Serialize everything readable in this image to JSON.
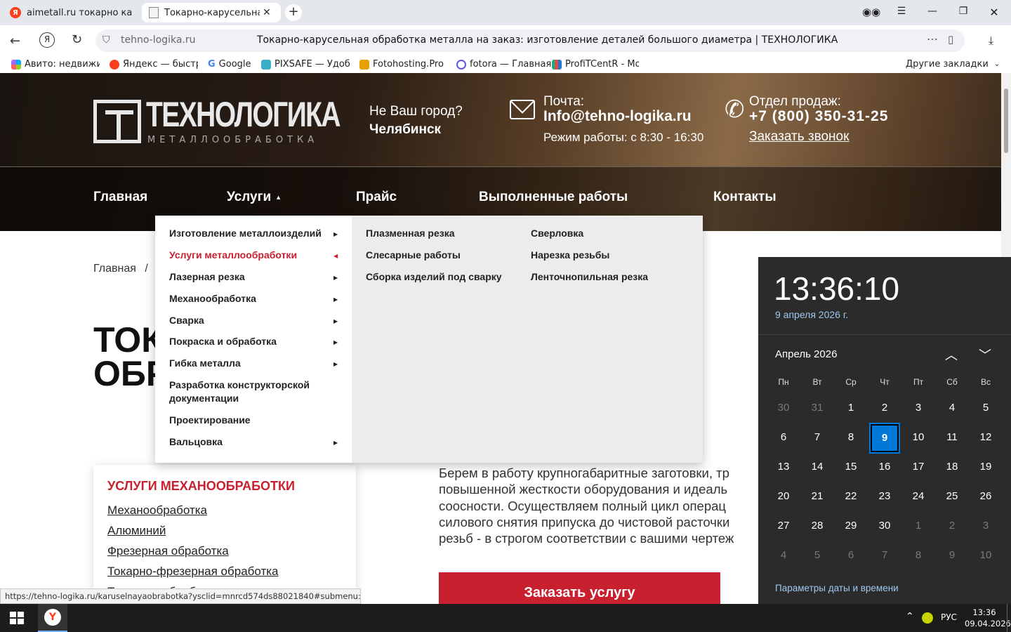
{
  "browser": {
    "tabs": [
      {
        "title": "aimetall.ru токарно карус"
      },
      {
        "title": "Токарно-карусельная о"
      }
    ],
    "new_tab": "+",
    "url": "tehno-logika.ru",
    "page_title": "Токарно-карусельная обработка металла на заказ: изготовление деталей большого диаметра | ТЕХНОЛОГИКА",
    "bookmarks": [
      "Авито: недвижим",
      "Яндекс — быстрі",
      "Google",
      "PIXSAFE — Удобн",
      "Fotohosting.Pro - ",
      "fotora — Главная",
      "ProfiTCentR - Мой"
    ],
    "other_bookmarks": "Другие закладки",
    "status_url": "https://tehno-logika.ru/karuselnayaobrabotka?ysclid=mnrcd574ds88021840#submenu:uslugi"
  },
  "site": {
    "logo_main": "ТЕХНОЛОГИКА",
    "logo_sub": "МЕТАЛЛООБРАБОТКА",
    "city_question": "Не Ваш город?",
    "city": "Челябинск",
    "mail_label": "Почта:",
    "mail": "Info@tehno-logika.ru",
    "hours": "Режим работы: с 8:30 - 16:30",
    "sales_label": "Отдел продаж:",
    "phone": "+7 (800) 350-31-25",
    "callback": "Заказать звонок",
    "nav": [
      "Главная",
      "Услуги",
      "Прайс",
      "Выполненные работы",
      "Контакты"
    ],
    "breadcrumb_home": "Главная",
    "breadcrumb_sep": "/",
    "title_line1": "ТОК",
    "title_line2": "ОБР",
    "menu_left": [
      "Изготовление металлоизделий",
      "Услуги металлообработки",
      "Лазерная резка",
      "Механообработка",
      "Сварка",
      "Покраска и обработка",
      "Гибка металла",
      "Разработка конструкторской документации",
      "Проектирование",
      "Вальцовка"
    ],
    "menu_col2": [
      "Плазменная резка",
      "Слесарные работы",
      "Сборка изделий под сварку"
    ],
    "menu_col3": [
      "Сверловка",
      "Нарезка резьбы",
      "Ленточнопильная резка"
    ],
    "side_title": "УСЛУГИ МЕХАНООБРАБОТКИ",
    "side_links": [
      "Механообработка",
      "Алюминий",
      "Фрезерная обработка",
      "Токарно-фрезерная обработка",
      "Токарная обработка"
    ],
    "body_lines": [
      "Берем в работу крупногабаритные заготовки, тр",
      "повышенной жесткости оборудования и идеаль",
      "соосности. Осуществляем полный цикл операц",
      "силового снятия припуска до чистовой расточки",
      "резьб - в строгом соответствии с вашими чертеж"
    ],
    "order_button": "Заказать услугу",
    "accent": "#c8202f"
  },
  "clock": {
    "time": "13:36:10",
    "date": "9 апреля 2026 г.",
    "month": "Апрель 2026",
    "weekdays": [
      "Пн",
      "Вт",
      "Ср",
      "Чт",
      "Пт",
      "Сб",
      "Вс"
    ],
    "days": [
      "30",
      "31",
      "1",
      "2",
      "3",
      "4",
      "5",
      "6",
      "7",
      "8",
      "9",
      "10",
      "11",
      "12",
      "13",
      "14",
      "15",
      "16",
      "17",
      "18",
      "19",
      "20",
      "21",
      "22",
      "23",
      "24",
      "25",
      "26",
      "27",
      "28",
      "29",
      "30",
      "1",
      "2",
      "3",
      "4",
      "5",
      "6",
      "7",
      "8",
      "9",
      "10"
    ],
    "today": "9",
    "settings": "Параметры даты и времени",
    "highlight_color": "#0078d7"
  },
  "taskbar": {
    "lang": "РУС",
    "time": "13:36",
    "date": "09.04.2026"
  }
}
